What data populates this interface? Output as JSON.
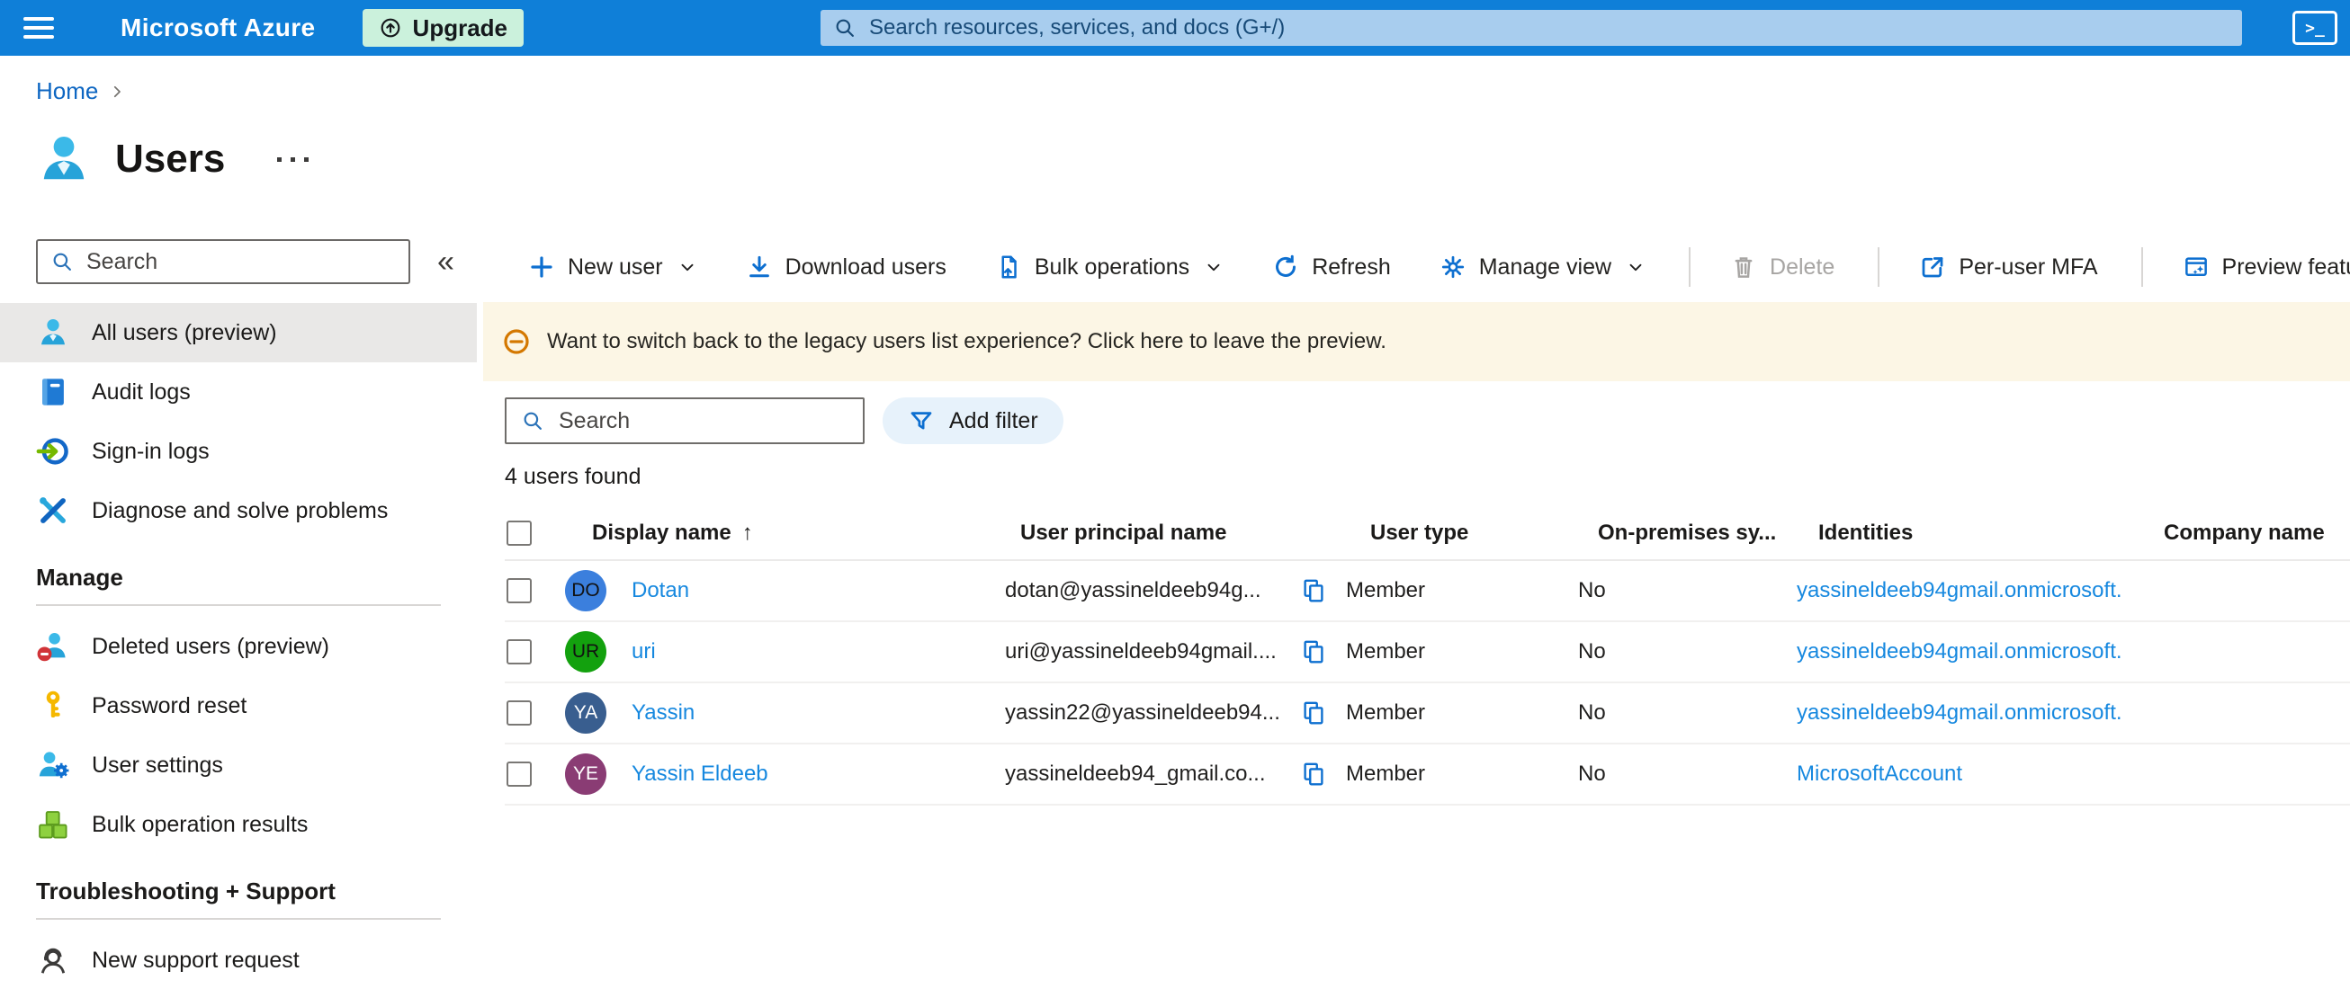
{
  "topbar": {
    "brand": "Microsoft Azure",
    "upgrade_label": "Upgrade",
    "search_placeholder": "Search resources, services, and docs (G+/)"
  },
  "breadcrumb": {
    "home": "Home"
  },
  "page": {
    "title": "Users"
  },
  "sidebar": {
    "search_placeholder": "Search",
    "items": [
      {
        "label": "All users (preview)",
        "selected": true
      },
      {
        "label": "Audit logs"
      },
      {
        "label": "Sign-in logs"
      },
      {
        "label": "Diagnose and solve problems"
      },
      {
        "label": "Deleted users (preview)"
      },
      {
        "label": "Password reset"
      },
      {
        "label": "User settings"
      },
      {
        "label": "Bulk operation results"
      },
      {
        "label": "New support request"
      }
    ],
    "section_headers": {
      "manage": "Manage",
      "troubleshooting": "Troubleshooting + Support"
    }
  },
  "toolbar": {
    "new_user": "New user",
    "download_users": "Download users",
    "bulk_operations": "Bulk operations",
    "refresh": "Refresh",
    "manage_view": "Manage view",
    "delete": "Delete",
    "per_user_mfa": "Per-user MFA",
    "preview_features": "Preview features"
  },
  "banner": {
    "message": "Want to switch back to the legacy users list experience? Click here to leave the preview."
  },
  "filters": {
    "search_placeholder": "Search",
    "add_filter": "Add filter"
  },
  "results_count": "4 users found",
  "table": {
    "columns": {
      "display_name": "Display name",
      "user_principal_name": "User principal name",
      "user_type": "User type",
      "on_premises": "On-premises sy...",
      "identities": "Identities",
      "company_name": "Company name"
    },
    "sort_indicator": "↑",
    "rows": [
      {
        "initials": "DO",
        "avatar_color": "#3b7fdd",
        "initials_color": "#111111",
        "name": "Dotan",
        "upn": "dotan@yassineldeeb94g...",
        "user_type": "Member",
        "on_premises": "No",
        "identities": "yassineldeeb94gmail.onmicrosoft."
      },
      {
        "initials": "UR",
        "avatar_color": "#13a10e",
        "initials_color": "#111111",
        "name": "uri",
        "upn": "uri@yassineldeeb94gmail....",
        "user_type": "Member",
        "on_premises": "No",
        "identities": "yassineldeeb94gmail.onmicrosoft."
      },
      {
        "initials": "YA",
        "avatar_color": "#395e8f",
        "initials_color": "#ffffff",
        "name": "Yassin",
        "upn": "yassin22@yassineldeeb94...",
        "user_type": "Member",
        "on_premises": "No",
        "identities": "yassineldeeb94gmail.onmicrosoft."
      },
      {
        "initials": "YE",
        "avatar_color": "#8a3c74",
        "initials_color": "#ffffff",
        "name": "Yassin Eldeeb",
        "upn": "yassineldeeb94_gmail.co...",
        "user_type": "Member",
        "on_premises": "No",
        "identities": "MicrosoftAccount"
      }
    ]
  },
  "colors": {
    "topbar_blue": "#0f7fd8",
    "accent_blue": "#0d6fd0",
    "link_blue": "#1688df",
    "upgrade_mint": "#cbf1dc",
    "banner_bg": "#fcf6e5",
    "banner_icon_orange": "#d47800",
    "selected_item_bg": "#e9e8e7"
  }
}
